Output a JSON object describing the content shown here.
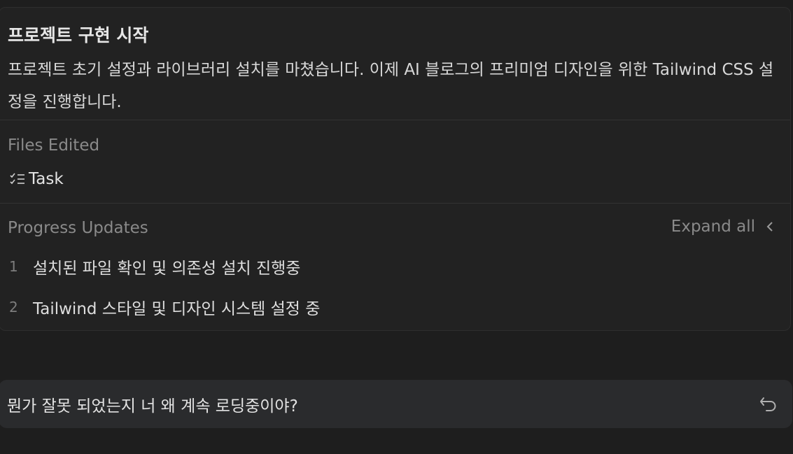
{
  "task": {
    "title": "프로젝트 구현 시작",
    "description": "프로젝트 초기 설정과 라이브러리 설치를 마쳤습니다. 이제 AI 블로그의 프리미엄 디자인을 위한 Tailwind CSS 설정을 진행합니다."
  },
  "files_edited": {
    "heading": "Files Edited",
    "items": [
      {
        "icon": "checklist-icon",
        "name": "Task"
      }
    ]
  },
  "progress": {
    "heading": "Progress Updates",
    "expand_label": "Expand all",
    "expand_icon": "chevron-left-icon",
    "items": [
      {
        "number": "1",
        "text": "설치된 파일 확인 및 의존성 설치 진행중"
      },
      {
        "number": "2",
        "text": "Tailwind 스타일 및 디자인 시스템 설정 중"
      }
    ]
  },
  "message": {
    "text": "뭔가 잘못 되었는지 너 왜 계속 로딩중이야?",
    "action_icon": "undo-icon"
  },
  "colors": {
    "background": "#1e1e1e",
    "card": "#222222",
    "input": "#2a2b2d",
    "muted_text": "#8a8a8a",
    "text": "#dcdcdc"
  }
}
